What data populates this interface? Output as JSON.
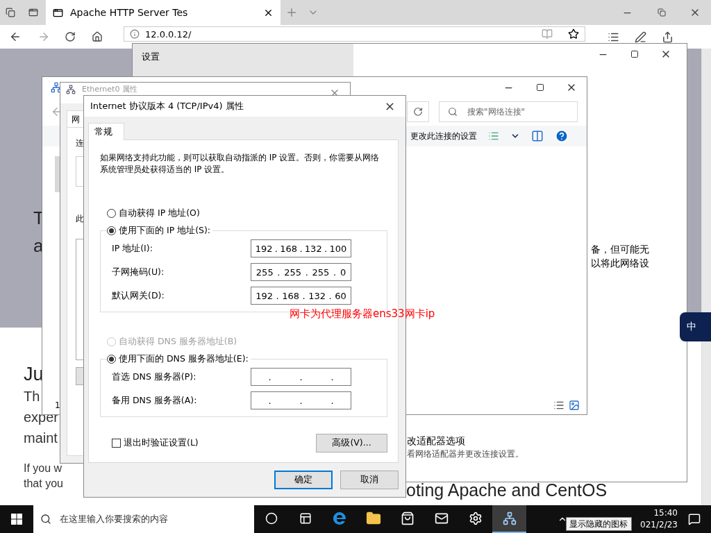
{
  "browser": {
    "tab_title": "Apache HTTP Server Tes",
    "address": "12.0.0.12/",
    "hero_lines": [
      "T",
      "a"
    ],
    "heading": "Ju",
    "lead_lines": [
      "Th",
      "exper",
      "maint"
    ],
    "paragraph_lines": [
      "If you w",
      "that you"
    ],
    "side_heading": "oting Apache and CentOS"
  },
  "settings_window": {
    "title": "设置",
    "text_lines": [
      "备，但可能无",
      "以将此网络设"
    ],
    "link": "改适配器选项",
    "link_desc": "看网络适配器并更改连接设置。"
  },
  "network_window": {
    "search_placeholder": "搜索\"网络连接\"",
    "command": "更改此连接的设置",
    "count": "1"
  },
  "ethernet_dialog": {
    "title": "Ethernet0 属性",
    "tab": "网",
    "label_1": "连",
    "label_2": "此"
  },
  "ipv4_dialog": {
    "title": "Internet 协议版本 4 (TCP/IPv4) 属性",
    "tabs": [
      {
        "label": "常规",
        "selected": true
      }
    ],
    "description": "如果网络支持此功能，则可以获取自动指派的 IP 设置。否则，你需要从网络系统管理员处获得适当的 IP 设置。",
    "ip_modes": [
      {
        "label": "自动获得 IP 地址(O)",
        "selected": false,
        "disabled": false
      },
      {
        "label": "使用下面的 IP 地址(S):",
        "selected": true,
        "disabled": false
      }
    ],
    "ip_fields": [
      {
        "label": "IP 地址(I):",
        "value": "192 . 168 . 132 . 100"
      },
      {
        "label": "子网掩码(U):",
        "value": "255 . 255 . 255 . 0"
      },
      {
        "label": "默认网关(D):",
        "value": "192 . 168 . 132 . 60"
      }
    ],
    "dns_modes": [
      {
        "label": "自动获得 DNS 服务器地址(B)",
        "selected": false,
        "disabled": true
      },
      {
        "label": "使用下面的 DNS 服务器地址(E):",
        "selected": true,
        "disabled": false
      }
    ],
    "dns_fields": [
      {
        "label": "首选 DNS 服务器(P):",
        "value": ". . ."
      },
      {
        "label": "备用 DNS 服务器(A):",
        "value": ". . ."
      }
    ],
    "validate": {
      "label": "退出时验证设置(L)",
      "checked": false
    },
    "advanced_button": "高级(V)...",
    "buttons": [
      {
        "label": "确定",
        "default": true
      },
      {
        "label": "取消",
        "default": false
      }
    ]
  },
  "annotation": "网卡为代理服务器ens33网卡ip",
  "ime": {
    "label": "中"
  },
  "taskbar": {
    "search_placeholder": "在这里输入你要搜索的内容",
    "apps": [
      {
        "kind": "cortana",
        "active": false
      },
      {
        "kind": "task_view",
        "active": false
      },
      {
        "kind": "edge",
        "active": false
      },
      {
        "kind": "explorer",
        "active": false
      },
      {
        "kind": "store",
        "active": false
      },
      {
        "kind": "mail",
        "active": false
      },
      {
        "kind": "settings",
        "active": false
      },
      {
        "kind": "network_app",
        "active": true
      }
    ],
    "tooltip": "显示隐藏的图标",
    "time": "15:40",
    "date": "021/2/23"
  }
}
